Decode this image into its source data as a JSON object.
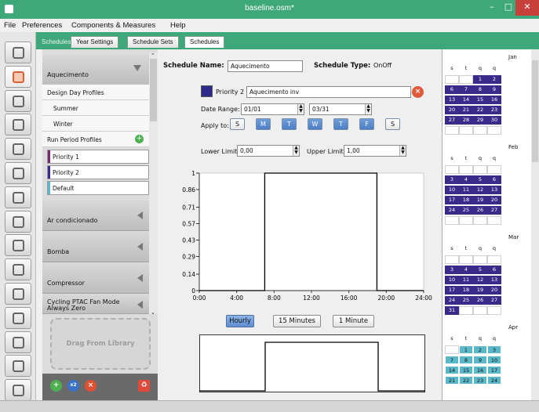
{
  "window": {
    "title": "baseline.osm*"
  },
  "menu": [
    "File",
    "Preferences",
    "Components & Measures",
    "Help"
  ],
  "icon_strip": [
    "site-icon",
    "schedules-icon",
    "constructions-icon",
    "loads-icon",
    "space-types-icon",
    "geometry-icon",
    "facility-icon",
    "spaces-icon",
    "thermal-zones-icon",
    "hvac-icon",
    "output-variables-icon",
    "simulation-settings-icon",
    "scripts-icon",
    "run-icon",
    "results-icon"
  ],
  "tabs": {
    "sub_schedules": "Schedules",
    "year_settings": "Year Settings",
    "schedule_sets": "Schedule Sets",
    "schedules": "Schedules"
  },
  "left": {
    "expanded_schedule": "Aquecimento",
    "design_day_profiles": "Design Day Profiles",
    "summer": "Summer",
    "winter": "Winter",
    "run_period_profiles": "Run Period Profiles",
    "priority1": "Priority 1",
    "priority2": "Priority 2",
    "default": "Default",
    "schedules": [
      "Ar condicionado",
      "Bomba",
      "Compressor"
    ],
    "cycling_line1": "Cycling PTAC Fan Mode",
    "cycling_line2": "Always Zero",
    "drag_label": "Drag From Library",
    "colors": {
      "priority1": "#7a2a6a",
      "priority2": "#3a2a8a",
      "default": "#5ab8c8"
    }
  },
  "main": {
    "schedule_name_label": "Schedule Name:",
    "schedule_name": "Aquecimento",
    "schedule_type_label": "Schedule Type:",
    "schedule_type": "OnOff",
    "priority_label": "Priority 2",
    "profile_name": "Aquecimento inv",
    "priority_color": "#2e2a8a",
    "date_range_label": "Date Range:",
    "date_start": "01/01",
    "date_end": "03/31",
    "apply_to_label": "Apply to:",
    "days": [
      {
        "label": "S",
        "on": false
      },
      {
        "label": "M",
        "on": true
      },
      {
        "label": "T",
        "on": true
      },
      {
        "label": "W",
        "on": true
      },
      {
        "label": "T",
        "on": true
      },
      {
        "label": "F",
        "on": true
      },
      {
        "label": "S",
        "on": false
      }
    ],
    "lower_limit_label": "Lower Limit:",
    "lower_limit": "0,00",
    "upper_limit_label": "Upper Limit:",
    "upper_limit": "1,00",
    "y_ticks": [
      "1",
      "0.86",
      "0.71",
      "0.57",
      "0.43",
      "0.29",
      "0.14",
      "0"
    ],
    "x_ticks": [
      "0:00",
      "4:00",
      "8:00",
      "12:00",
      "16:00",
      "20:00",
      "24:00"
    ],
    "precision_buttons": [
      {
        "label": "Hourly",
        "on": true
      },
      {
        "label": "15 Minutes",
        "on": false
      },
      {
        "label": "1 Minute",
        "on": false
      }
    ]
  },
  "chart_data": {
    "type": "line",
    "x": [
      0,
      7,
      7,
      19,
      19,
      24
    ],
    "y": [
      0,
      0,
      1,
      1,
      0,
      0
    ],
    "xlim": [
      0,
      24
    ],
    "ylim": [
      0,
      1
    ],
    "xlabel": "",
    "ylabel": "",
    "title": ""
  },
  "calendar": {
    "weekday_headers": [
      "s",
      "t",
      "q",
      "q"
    ],
    "highlight_color": "#3a2a8a",
    "months": [
      {
        "name": "Jan",
        "days": [
          "",
          "",
          "1",
          "2",
          "6",
          "7",
          "8",
          "9",
          "13",
          "14",
          "15",
          "16",
          "20",
          "21",
          "22",
          "23",
          "27",
          "28",
          "29",
          "30",
          "",
          "",
          "",
          ""
        ]
      },
      {
        "name": "Feb",
        "days": [
          "",
          "",
          "",
          "",
          "3",
          "4",
          "5",
          "6",
          "10",
          "11",
          "12",
          "13",
          "17",
          "18",
          "19",
          "20",
          "24",
          "25",
          "26",
          "27",
          "",
          "",
          "",
          ""
        ]
      },
      {
        "name": "Mar",
        "days": [
          "",
          "",
          "",
          "",
          "3",
          "4",
          "5",
          "6",
          "10",
          "11",
          "12",
          "13",
          "17",
          "18",
          "19",
          "20",
          "24",
          "25",
          "26",
          "27",
          "31",
          "",
          "",
          ""
        ]
      },
      {
        "name": "Apr",
        "days": [
          "",
          "1",
          "2",
          "3",
          "7",
          "8",
          "9",
          "10",
          "14",
          "15",
          "16",
          "17",
          "21",
          "22",
          "23",
          "24"
        ]
      }
    ]
  }
}
